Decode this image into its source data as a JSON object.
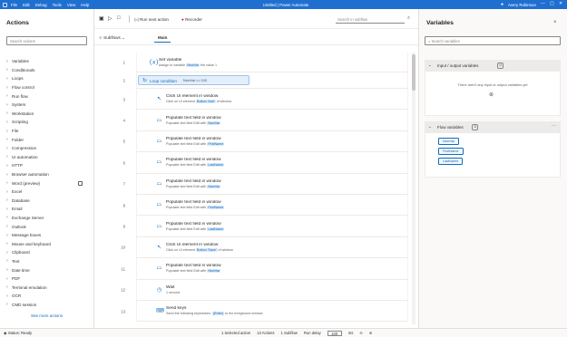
{
  "window": {
    "title": "Untitled | Power Automate",
    "menu": [
      "File",
      "Edit",
      "Debug",
      "Tools",
      "View",
      "Help"
    ],
    "user": "Avery Robinson",
    "accent": "#1f6fd1"
  },
  "actions_panel": {
    "title": "Actions",
    "search_placeholder": "Search actions",
    "groups": [
      {
        "label": "Variables"
      },
      {
        "label": "Conditionals"
      },
      {
        "label": "Loops"
      },
      {
        "label": "Flow control"
      },
      {
        "label": "Run flow"
      },
      {
        "label": "System"
      },
      {
        "label": "Workstation"
      },
      {
        "label": "Scripting"
      },
      {
        "label": "File"
      },
      {
        "label": "Folder"
      },
      {
        "label": "Compression"
      },
      {
        "label": "UI automation"
      },
      {
        "label": "HTTP"
      },
      {
        "label": "Browser automation"
      },
      {
        "label": "Word (preview)",
        "badge_icon": "preview-icon"
      },
      {
        "label": "Excel"
      },
      {
        "label": "Database"
      },
      {
        "label": "Email"
      },
      {
        "label": "Exchange Server"
      },
      {
        "label": "Outlook"
      },
      {
        "label": "Message boxes"
      },
      {
        "label": "Mouse and keyboard"
      },
      {
        "label": "Clipboard"
      },
      {
        "label": "Text"
      },
      {
        "label": "Date time"
      },
      {
        "label": "PDF"
      },
      {
        "label": "Terminal emulation"
      },
      {
        "label": "OCR"
      },
      {
        "label": "CMD session"
      }
    ],
    "see_more": "See more actions"
  },
  "toolbar": {
    "run_next": "Run next action",
    "recorder": "Recorder",
    "search_placeholder": "Search in subflow"
  },
  "tabs": {
    "subflows": "Subflows",
    "main": "Main"
  },
  "flow": {
    "steps": [
      {
        "number": "1",
        "level": "top",
        "icon": "set-variable-icon",
        "glyph": "{x}",
        "title": "Set variable",
        "desc": "Assign to variable",
        "highlight": "NewVar",
        "desc_after": "the value 1"
      },
      {
        "number": "2",
        "level": "loop",
        "icon": "loop-icon",
        "glyph": "↻",
        "title": "Loop condition",
        "condition": "NewVar <= 100",
        "selected": true
      },
      {
        "number": "3",
        "level": "nested",
        "icon": "click-icon",
        "glyph": "↖",
        "title": "Click UI element in window",
        "desc": "Click on UI element",
        "highlight": "Button 'Add'",
        "desc_after": "of window"
      },
      {
        "number": "4",
        "level": "nested",
        "icon": "text-field-icon",
        "glyph": "▭",
        "title": "Populate text field in window",
        "desc": "Populate text field Edit with",
        "highlight": "NewVar",
        "desc_after": ""
      },
      {
        "number": "5",
        "level": "nested",
        "icon": "text-field-icon",
        "glyph": "▭",
        "title": "Populate text field in window",
        "desc": "Populate text field Edit with",
        "highlight": "FirstName",
        "desc_after": ""
      },
      {
        "number": "6",
        "level": "nested",
        "icon": "text-field-icon",
        "glyph": "▭",
        "title": "Populate text field in window",
        "desc": "Populate text field Edit with",
        "highlight": "LastName",
        "desc_after": ""
      },
      {
        "number": "7",
        "level": "nested",
        "icon": "text-field-icon",
        "glyph": "▭",
        "title": "Populate text field in window",
        "desc": "Populate text field Edit with",
        "highlight": "NewVar",
        "desc_after": ""
      },
      {
        "number": "8",
        "level": "nested",
        "icon": "text-field-icon",
        "glyph": "▭",
        "title": "Populate text field in window",
        "desc": "Populate text field Edit with",
        "highlight": "FirstName",
        "desc_after": ""
      },
      {
        "number": "9",
        "level": "nested",
        "icon": "text-field-icon",
        "glyph": "▭",
        "title": "Populate text field in window",
        "desc": "Populate text field Edit with",
        "highlight": "LastName",
        "desc_after": ""
      },
      {
        "number": "10",
        "level": "nested",
        "icon": "click-icon",
        "glyph": "↖",
        "title": "Click UI element in window",
        "desc": "Click on UI element",
        "highlight": "Button 'Save'",
        "desc_after": "of window"
      },
      {
        "number": "11",
        "level": "nested",
        "icon": "text-field-icon",
        "glyph": "▭",
        "title": "Populate text field in window",
        "desc": "Populate text field Edit with",
        "highlight": "NewVar",
        "desc_after": ""
      },
      {
        "number": "12",
        "level": "nested",
        "icon": "wait-icon",
        "glyph": "◷",
        "title": "Wait",
        "desc": "1 second",
        "highlight": "",
        "desc_after": ""
      },
      {
        "number": "13",
        "level": "nested",
        "icon": "keyboard-icon",
        "glyph": "⌨",
        "title": "Send keys",
        "desc": "Send the following keystrokes:",
        "highlight": "{Enter}",
        "desc_after": "to the foreground window"
      }
    ]
  },
  "variables_panel": {
    "title": "Variables",
    "search_placeholder": "Search variables",
    "io_section": {
      "title": "Input / output variables",
      "count": "0",
      "empty_text": "There aren't any input or output variables yet"
    },
    "flow_section": {
      "title": "Flow variables",
      "count": "3",
      "variables": [
        "NewVar",
        "FirstName",
        "LastName"
      ]
    }
  },
  "status_bar": {
    "status": "Status: Ready",
    "selected": "1 Selected action",
    "actions": "13 Actions",
    "subflows": "1 Subflow",
    "run_delay_label": "Run delay",
    "run_delay_value": "100",
    "run_delay_unit": "ms"
  }
}
